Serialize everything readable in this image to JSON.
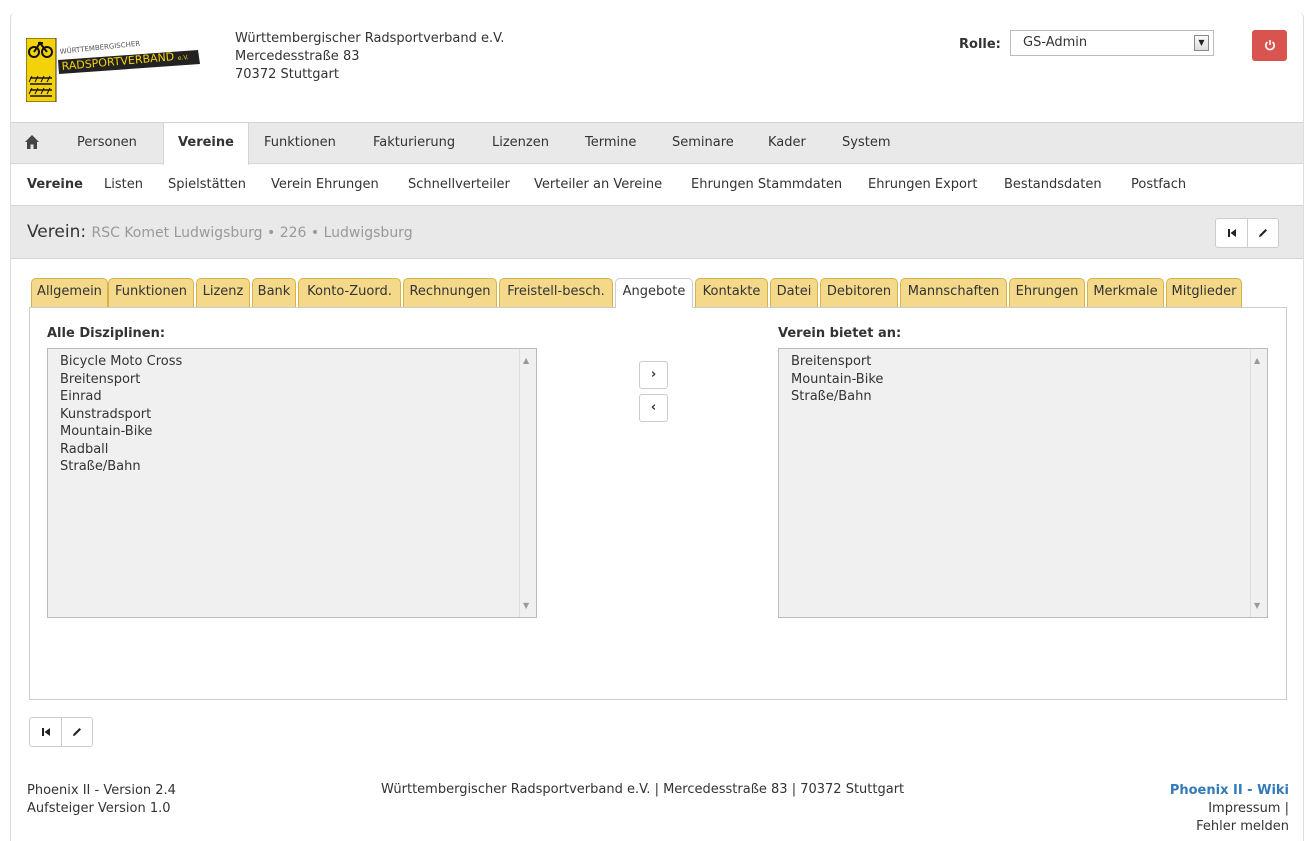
{
  "header": {
    "org_line1": "Württembergischer Radsportverband e.V.",
    "org_line2": "Mercedesstraße 83",
    "org_line3": "70372 Stuttgart",
    "logo_text_top": "WÜRTTEMBERGISCHER",
    "logo_text_main": "RADSPORTVERBAND",
    "logo_text_ev": "e.V.",
    "rolle_label": "Rolle:",
    "rolle_value": "GS-Admin",
    "power_icon": "power-icon"
  },
  "mainnav": {
    "home_icon": "home-icon",
    "items": [
      "Personen",
      "Vereine",
      "Funktionen",
      "Fakturierung",
      "Lizenzen",
      "Termine",
      "Seminare",
      "Kader",
      "System"
    ],
    "active": "Vereine"
  },
  "subnav": {
    "items": [
      "Vereine",
      "Listen",
      "Spielstätten",
      "Verein Ehrungen",
      "Schnellverteiler",
      "Verteiler an Vereine",
      "Ehrungen Stammdaten",
      "Ehrungen Export",
      "Bestandsdaten",
      "Postfach"
    ],
    "active": "Vereine"
  },
  "titlebar": {
    "label": "Verein:",
    "subtitle": "RSC Komet Ludwigsburg • 226 • Ludwigsburg"
  },
  "tabs": {
    "items": [
      "Allgemein",
      "Funktionen",
      "Lizenz",
      "Bank",
      "Konto-Zuord.",
      "Rechnungen",
      "Freistell-besch.",
      "Angebote",
      "Kontakte",
      "Datei",
      "Debitoren",
      "Mannschaften",
      "Ehrungen",
      "Merkmale",
      "Mitglieder"
    ],
    "active": "Angebote"
  },
  "angebote": {
    "left_label": "Alle Disziplinen:",
    "left_items": [
      "Bicycle Moto Cross",
      "Breitensport",
      "Einrad",
      "Kunstradsport",
      "Mountain-Bike",
      "Radball",
      "Straße/Bahn"
    ],
    "right_label": "Verein bietet an:",
    "right_items": [
      "Breitensport",
      "Mountain-Bike",
      "Straße/Bahn"
    ],
    "add_icon": "chevron-right-icon",
    "remove_icon": "chevron-left-icon"
  },
  "footer": {
    "version": "Phoenix II - Version 2.4",
    "aufsteiger": "Aufsteiger Version 1.0",
    "center": "Württembergischer Radsportverband e.V. | Mercedesstraße 83 | 70372 Stuttgart",
    "wiki": "Phoenix II - Wiki",
    "impressum": "Impressum |",
    "fehler": "Fehler melden"
  }
}
